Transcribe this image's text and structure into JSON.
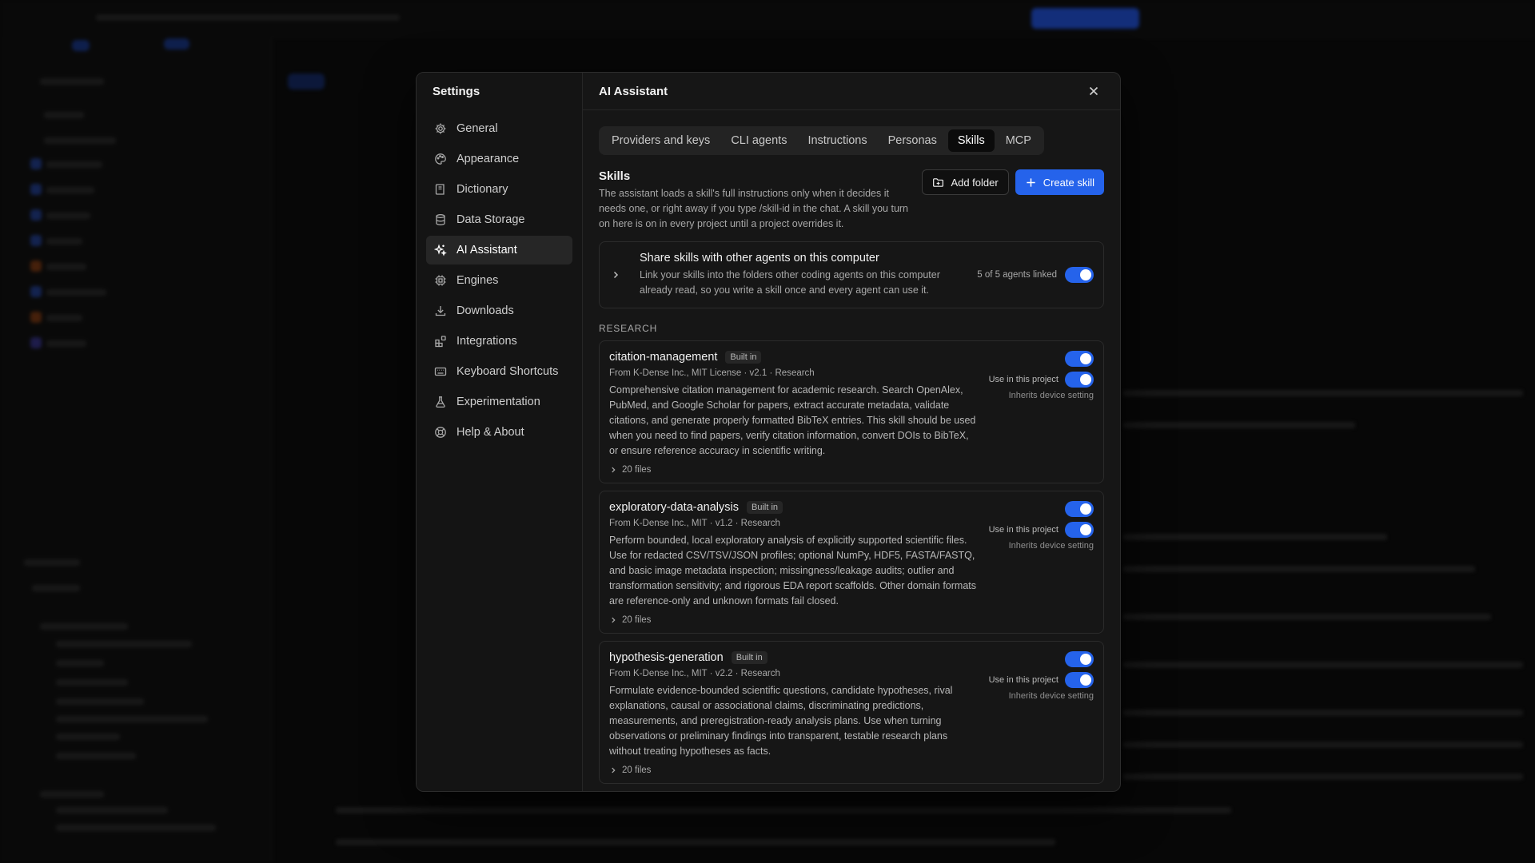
{
  "settings_title": "Settings",
  "nav_items": [
    {
      "label": "General",
      "icon": "gear-icon"
    },
    {
      "label": "Appearance",
      "icon": "palette-icon"
    },
    {
      "label": "Dictionary",
      "icon": "book-icon"
    },
    {
      "label": "Data Storage",
      "icon": "database-icon"
    },
    {
      "label": "AI Assistant",
      "icon": "sparkles-icon",
      "active": true
    },
    {
      "label": "Engines",
      "icon": "cpu-icon"
    },
    {
      "label": "Downloads",
      "icon": "download-icon"
    },
    {
      "label": "Integrations",
      "icon": "blocks-icon"
    },
    {
      "label": "Keyboard Shortcuts",
      "icon": "keyboard-icon"
    },
    {
      "label": "Experimentation",
      "icon": "flask-icon"
    },
    {
      "label": "Help & About",
      "icon": "lifebuoy-icon"
    }
  ],
  "main_title": "AI Assistant",
  "tabs": [
    {
      "label": "Providers and keys"
    },
    {
      "label": "CLI agents"
    },
    {
      "label": "Instructions"
    },
    {
      "label": "Personas"
    },
    {
      "label": "Skills",
      "active": true
    },
    {
      "label": "MCP"
    }
  ],
  "skills": {
    "title": "Skills",
    "description": "The assistant loads a skill's full instructions only when it decides it needs one, or right away if you type /skill-id in the chat. A skill you turn on here is on in every project until a project overrides it.",
    "add_folder_label": "Add folder",
    "create_skill_label": "Create skill"
  },
  "share": {
    "title": "Share skills with other agents on this computer",
    "description": "Link your skills into the folders other coding agents on this computer already read, so you write a skill once and every agent can use it.",
    "status": "5 of 5 agents linked",
    "enabled": true
  },
  "section_label": "RESEARCH",
  "skill_cards": [
    {
      "name": "citation-management",
      "badge": "Built in",
      "meta": "From K-Dense Inc., MIT License · v2.1 · Research",
      "description": "Comprehensive citation management for academic research. Search OpenAlex, PubMed, and Google Scholar for papers, extract accurate metadata, validate citations, and generate properly formatted BibTeX entries. This skill should be used when you need to find papers, verify citation information, convert DOIs to BibTeX, or ensure reference accuracy in scientific writing.",
      "files": "20 files",
      "project_label": "Use in this project",
      "inherits": "Inherits device setting",
      "enabled": true,
      "project_enabled": true
    },
    {
      "name": "exploratory-data-analysis",
      "badge": "Built in",
      "meta": "From K-Dense Inc., MIT · v1.2 · Research",
      "description": "Perform bounded, local exploratory analysis of explicitly supported scientific files. Use for redacted CSV/TSV/JSON profiles; optional NumPy, HDF5, FASTA/FASTQ, and basic image metadata inspection; missingness/leakage audits; outlier and transformation sensitivity; and rigorous EDA report scaffolds. Other domain formats are reference-only and unknown formats fail closed.",
      "files": "20 files",
      "project_label": "Use in this project",
      "inherits": "Inherits device setting",
      "enabled": true,
      "project_enabled": true
    },
    {
      "name": "hypothesis-generation",
      "badge": "Built in",
      "meta": "From K-Dense Inc., MIT · v2.2 · Research",
      "description": "Formulate evidence-bounded scientific questions, candidate hypotheses, rival explanations, causal or associational claims, discriminating predictions, measurements, and preregistration-ready analysis plans. Use when turning observations or preliminary findings into transparent, testable research plans without treating hypotheses as facts.",
      "files": "20 files",
      "project_label": "Use in this project",
      "inherits": "Inherits device setting",
      "enabled": true,
      "project_enabled": true
    }
  ],
  "colors": {
    "accent": "#2563eb",
    "dialog_bg": "#161616",
    "backdrop": "#070707"
  }
}
